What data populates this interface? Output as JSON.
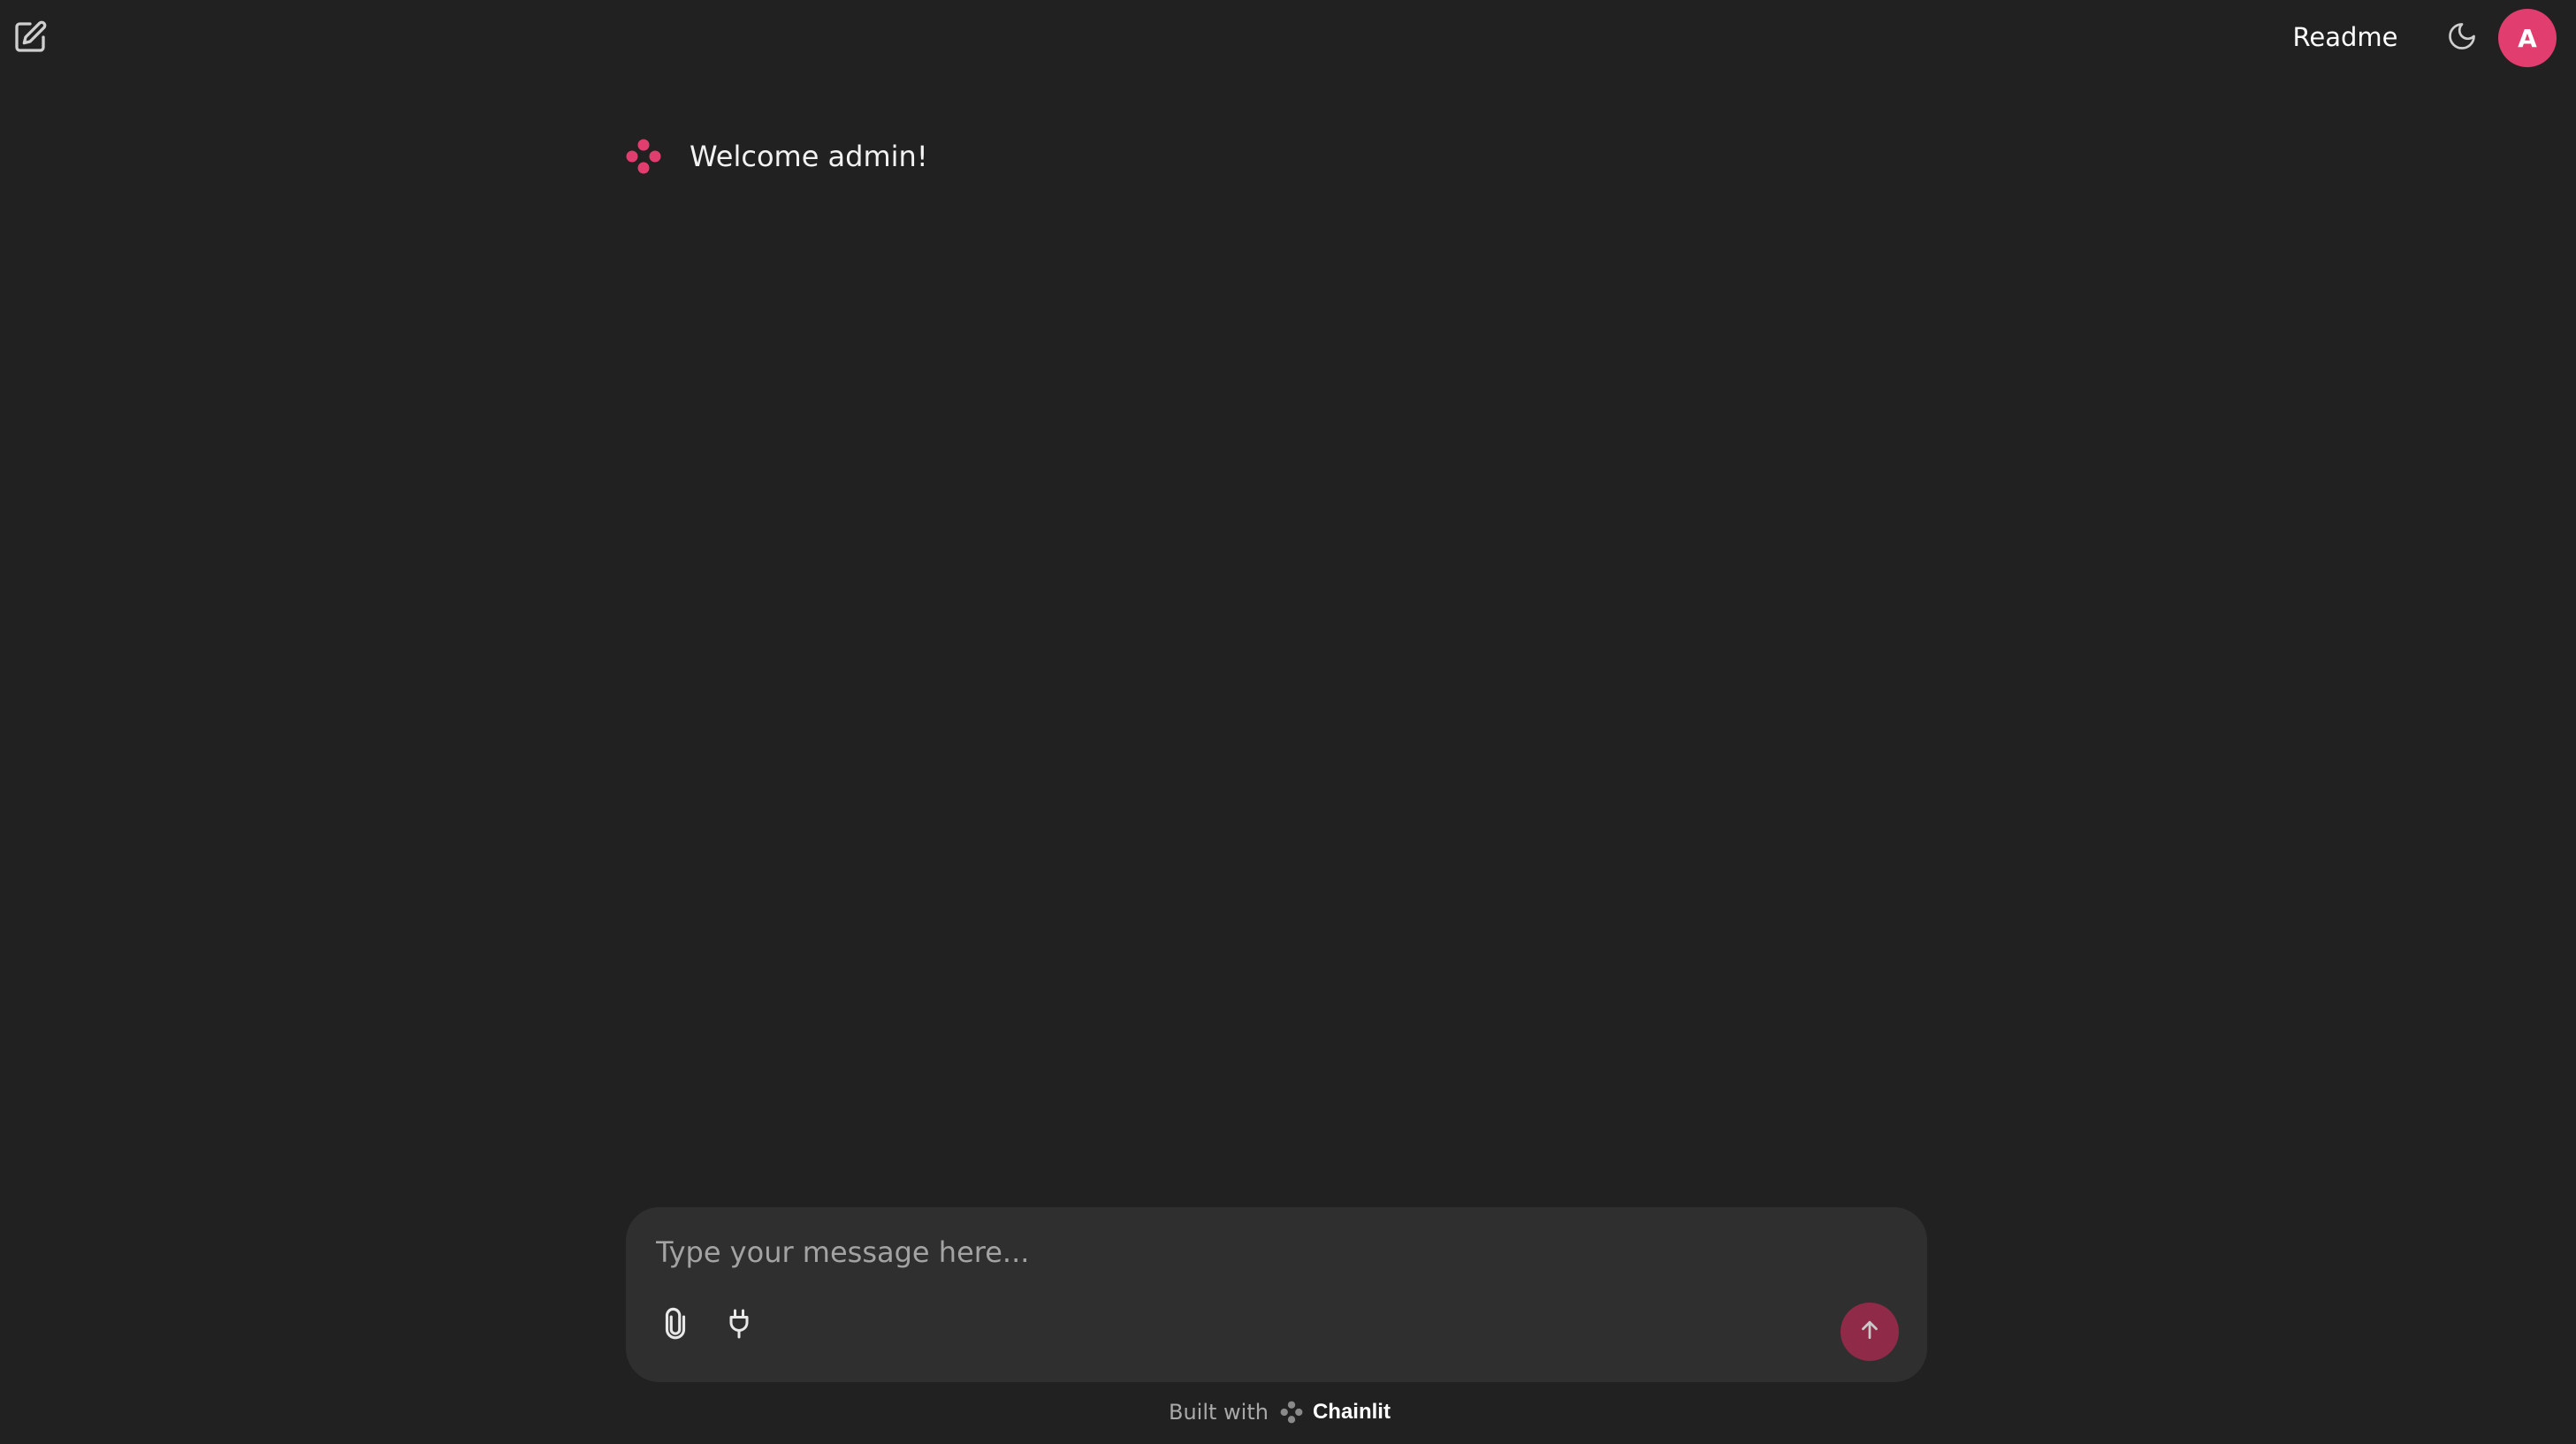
{
  "header": {
    "new_chat_icon": "edit-square-icon",
    "readme_label": "Readme",
    "theme_icon": "moon-icon",
    "avatar_initial": "A"
  },
  "messages": [
    {
      "author_icon": "chainlit-logo-icon",
      "text": "Welcome admin!"
    }
  ],
  "composer": {
    "placeholder": "Type your message here...",
    "value": "",
    "attach_icon": "paperclip-icon",
    "mcp_icon": "plug-icon",
    "send_icon": "arrow-up-icon"
  },
  "footer": {
    "built_with_label": "Built with",
    "brand": "Chainlit"
  },
  "colors": {
    "background": "#212121",
    "composer_bg": "#2f2f2f",
    "accent": "#e23d6f",
    "send_button": "#8f2a48"
  }
}
